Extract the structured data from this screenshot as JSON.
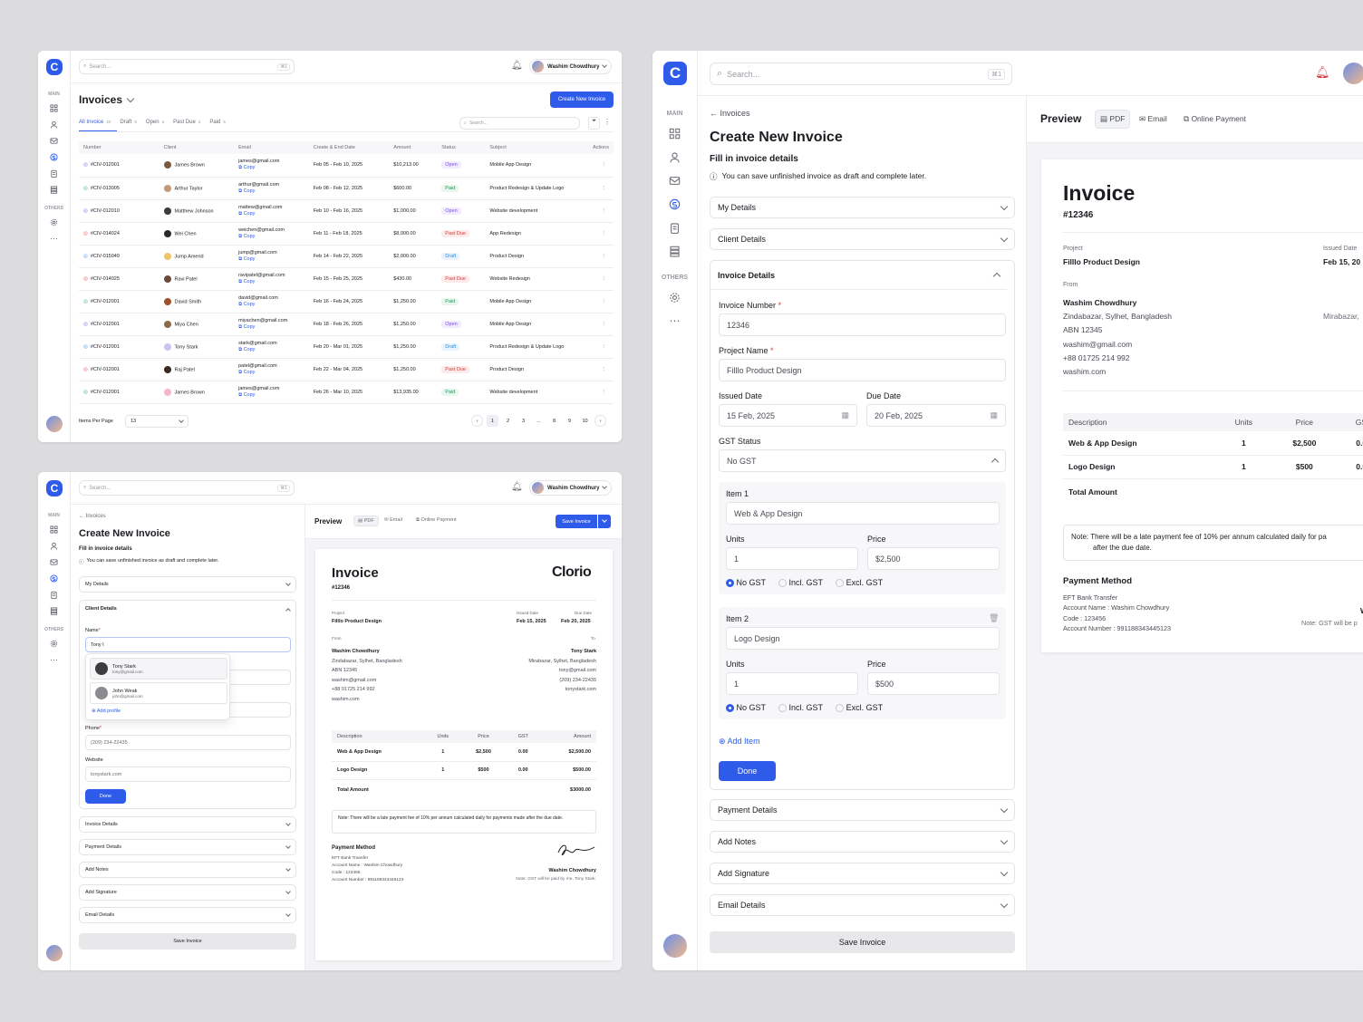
{
  "app": {
    "logo": "C",
    "user": "Washim Chowdhury",
    "search_placeholder": "Search...",
    "shortcut": "⌘1",
    "main_section": "MAIN",
    "others_section": "OTHERS"
  },
  "icons": {
    "dashboard": "grid-icon",
    "users": "user-icon",
    "mail": "mail-icon",
    "invoices": "invoice-icon",
    "clipboard": "clipboard-icon",
    "stack": "stack-icon",
    "settings": "gear-icon",
    "more": "more-icon",
    "notification": "bell-icon"
  },
  "colors": {
    "accent": "#2f5bea",
    "open": "#7b4ee2",
    "paid": "#1e9e5b",
    "past_due": "#d93a3a",
    "draft": "#2f8ae0"
  },
  "list": {
    "title": "Invoices",
    "create_button": "Create New Invoice",
    "tabs": [
      {
        "label": "All Invoice",
        "count": "20"
      },
      {
        "label": "Draft",
        "count": "5"
      },
      {
        "label": "Open",
        "count": "5"
      },
      {
        "label": "Past Due",
        "count": "3"
      },
      {
        "label": "Paid",
        "count": "5"
      }
    ],
    "table_search": "Search...",
    "columns": [
      "Number",
      "Client",
      "Email",
      "Create & End Date",
      "Amount",
      "Status",
      "Subject",
      "Actions"
    ],
    "copy_label": "Copy",
    "rows": [
      {
        "number": "#CIV-012001",
        "client": "James Brown",
        "email": "james@gmail.com",
        "dates": "Feb 05 - Feb 10, 2025",
        "amount": "$10,213.00",
        "status": "Open",
        "subject": "Mobile App Design"
      },
      {
        "number": "#CIV-013005",
        "client": "Arthur Taylor",
        "email": "arthur@gmail.com",
        "dates": "Feb 08 - Feb 12, 2025",
        "amount": "$600.00",
        "status": "Paid",
        "subject": "Product Redesign & Update Logo"
      },
      {
        "number": "#CIV-012010",
        "client": "Matthew Johnson",
        "email": "mattew@gmail.com",
        "dates": "Feb 10 - Feb 16, 2025",
        "amount": "$1,000.00",
        "status": "Open",
        "subject": "Website development"
      },
      {
        "number": "#CIV-014024",
        "client": "Wei Chen",
        "email": "weichen@gmail.com",
        "dates": "Feb 11 - Feb 18, 2025",
        "amount": "$8,000.00",
        "status": "Past Due",
        "subject": "App Redesign"
      },
      {
        "number": "#CIV-015049",
        "client": "Jump Amend",
        "email": "jump@gmail.com",
        "dates": "Feb 14 - Feb 22, 2025",
        "amount": "$2,000.00",
        "status": "Draft",
        "subject": "Product Design"
      },
      {
        "number": "#CIV-014025",
        "client": "Ravi Patel",
        "email": "ravipatel@gmail.com",
        "dates": "Feb 15 - Feb 25, 2025",
        "amount": "$430.00",
        "status": "Past Due",
        "subject": "Website Redesign"
      },
      {
        "number": "#CIV-012001",
        "client": "David Smith",
        "email": "david@gmail.com",
        "dates": "Feb 16 - Feb 24, 2025",
        "amount": "$1,250.00",
        "status": "Paid",
        "subject": "Mobile App Design"
      },
      {
        "number": "#CIV-012001",
        "client": "Miya Chen",
        "email": "miyachen@gmail.com",
        "dates": "Feb 18 - Feb 26, 2025",
        "amount": "$1,250.00",
        "status": "Open",
        "subject": "Mobile App Design"
      },
      {
        "number": "#CIV-012001",
        "client": "Tony Stark",
        "email": "stark@gmail.com",
        "dates": "Feb 20 - Mar 01, 2025",
        "amount": "$1,250.00",
        "status": "Draft",
        "subject": "Product Redesign & Update Logo"
      },
      {
        "number": "#CIV-012001",
        "client": "Raj Patel",
        "email": "patel@gmail.com",
        "dates": "Feb 22 - Mar 04, 2025",
        "amount": "$1,250.00",
        "status": "Past Due",
        "subject": "Product Design"
      },
      {
        "number": "#CIV-012001",
        "client": "James Brown",
        "email": "james@gmail.com",
        "dates": "Feb 26 - Mar 10, 2025",
        "amount": "$13,935.00",
        "status": "Paid",
        "subject": "Website development"
      }
    ],
    "items_per_page_label": "Items Per Page",
    "items_per_page": "13",
    "pages": [
      "1",
      "2",
      "3",
      "...",
      "8",
      "9",
      "10"
    ]
  },
  "create": {
    "back": "Invoices",
    "title": "Create New Invoice",
    "subtitle": "Fill in invoice details",
    "info": "You can save unfinished invoice as draft and complete later.",
    "my_details": "My Details",
    "client_details": "Client Details",
    "invoice_details": "Invoice Details",
    "payment_details": "Payment Details",
    "add_notes": "Add Notes",
    "add_signature": "Add Signature",
    "email_details": "Email Details",
    "save": "Save Invoice",
    "done": "Done",
    "client_form": {
      "name_label": "Name",
      "name_value": "Tony I",
      "suggestions": [
        {
          "name": "Tony Stark",
          "email": "tony@gmail.com"
        },
        {
          "name": "John Weak",
          "email": "john@gmail.com"
        }
      ],
      "add_profile": "Add profile",
      "phone_label": "Phone",
      "phone_value": "(209) 234-22435",
      "website_label": "Website",
      "website_value": "tonystark.com"
    },
    "invoice_form": {
      "number_label": "Invoice Number",
      "number_value": "12346",
      "project_label": "Project Name",
      "project_value": "Filllo Product Design",
      "issued_label": "Issued Date",
      "issued_value": "15 Feb, 2025",
      "due_label": "Due Date",
      "due_value": "20 Feb, 2025",
      "gst_label": "GST Status",
      "gst_value": "No GST",
      "units_label": "Units",
      "price_label": "Price",
      "gst_options": [
        "No GST",
        "Incl. GST",
        "Excl. GST"
      ],
      "items": [
        {
          "label": "Item 1",
          "name": "Web & App Design",
          "units": "1",
          "price": "$2,500"
        },
        {
          "label": "Item 2",
          "name": "Logo Design",
          "units": "1",
          "price": "$500"
        }
      ],
      "add_item": "Add Item"
    }
  },
  "preview": {
    "title": "Preview",
    "tabs": [
      "PDF",
      "Email",
      "Online Payment"
    ],
    "save": "Save Invoice",
    "doc": {
      "heading": "Invoice",
      "number": "#12346",
      "brand": "Clorio",
      "project_label": "Project",
      "project": "Filllo Product Design",
      "issued_label": "Issued Date",
      "issued": "Feb 15, 2025",
      "issued_cut": "Feb 15, 20",
      "due_label": "Due Date",
      "due": "Feb 20, 2025",
      "from_label": "From",
      "to_label": "To",
      "from": [
        "Washim Chowdhury",
        "Zindabazar, Sylhet, Bangladesh",
        "ABN 12345",
        "washim@gmail.com",
        "+88 01725 214 992",
        "washim.com"
      ],
      "to": [
        "Tony Stark",
        "Mirabazar, Sylhet, Bangladesh",
        "tony@gmail.com",
        "(209) 234-22435",
        "tonystark.com"
      ],
      "to_cut": "Mirabazar,",
      "columns": [
        "Description",
        "Units",
        "Price",
        "GST",
        "Amount"
      ],
      "items": [
        {
          "desc": "Web & App Design",
          "units": "1",
          "price": "$2,500",
          "gst": "0.00",
          "amount": "$2,500.00"
        },
        {
          "desc": "Logo Design",
          "units": "1",
          "price": "$500",
          "gst": "0.00",
          "amount": "$500.00"
        }
      ],
      "total_label": "Total Amount",
      "total": "$3000.00",
      "note_label": "Note:",
      "note": "There will be a late payment fee of 10% per annum calculated daily for payments made after the due date.",
      "note_line1": "There will be a late payment fee of 10% per annum calculated daily for pa",
      "note_line2": "after the due date.",
      "pm_title": "Payment Method",
      "pm_lines": [
        "EFT Bank Transfer",
        "Account Name : Washim Chowdhury",
        "Code : 123456",
        "Account Number : 991188343445123"
      ],
      "signer": "Washim Chowdhury",
      "gst_note": "Note: GST will be paid by me, Tony Stark.",
      "gst_note_cut": "Note: GST will be p",
      "signer_cut": "W"
    }
  }
}
